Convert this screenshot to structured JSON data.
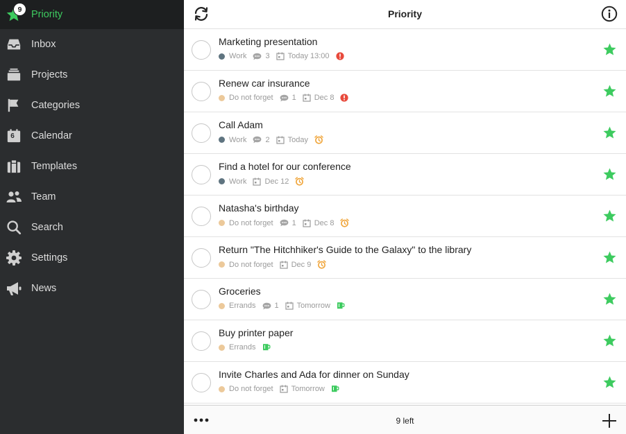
{
  "colors": {
    "accent": "#3dcb5f",
    "sidebar_bg": "#2b2d2f",
    "work_dot": "#5f7480",
    "soft_dot": "#ecc99a",
    "urgent": "#e84a3c",
    "reminder": "#f0a53a",
    "coffee": "#3dcb5f"
  },
  "sidebar": {
    "items": [
      {
        "label": "Priority",
        "icon": "star-icon",
        "badge": "9",
        "active": true
      },
      {
        "label": "Inbox",
        "icon": "inbox-icon"
      },
      {
        "label": "Projects",
        "icon": "projects-icon"
      },
      {
        "label": "Categories",
        "icon": "flag-icon"
      },
      {
        "label": "Calendar",
        "icon": "calendar-icon",
        "day": "6"
      },
      {
        "label": "Templates",
        "icon": "clipboard-icon"
      },
      {
        "label": "Team",
        "icon": "team-icon"
      },
      {
        "label": "Search",
        "icon": "search-icon"
      },
      {
        "label": "Settings",
        "icon": "gear-icon"
      },
      {
        "label": "News",
        "icon": "megaphone-icon"
      }
    ]
  },
  "header": {
    "title": "Priority"
  },
  "tasks": [
    {
      "title": "Marketing presentation",
      "category": "Work",
      "dot": "#5f7480",
      "comments": "3",
      "date": "Today 13:00",
      "status": "urgent"
    },
    {
      "title": "Renew car insurance",
      "category": "Do not forget",
      "dot": "#ecc99a",
      "comments": "1",
      "date": "Dec 8",
      "status": "urgent"
    },
    {
      "title": "Call Adam",
      "category": "Work",
      "dot": "#5f7480",
      "comments": "2",
      "date": "Today",
      "status": "reminder"
    },
    {
      "title": "Find a hotel for our conference",
      "category": "Work",
      "dot": "#5f7480",
      "date": "Dec 12",
      "status": "reminder"
    },
    {
      "title": "Natasha's birthday",
      "category": "Do not forget",
      "dot": "#ecc99a",
      "comments": "1",
      "date": "Dec 8",
      "status": "reminder"
    },
    {
      "title": "Return \"The Hitchhiker's Guide to the Galaxy\" to the library",
      "category": "Do not forget",
      "dot": "#ecc99a",
      "date": "Dec 9",
      "status": "reminder"
    },
    {
      "title": "Groceries",
      "category": "Errands",
      "dot": "#ecc99a",
      "comments": "1",
      "date": "Tomorrow",
      "status": "coffee"
    },
    {
      "title": "Buy printer paper",
      "category": "Errands",
      "dot": "#ecc99a",
      "status": "coffee"
    },
    {
      "title": "Invite Charles and Ada for dinner on Sunday",
      "category": "Do not forget",
      "dot": "#ecc99a",
      "date": "Tomorrow",
      "status": "coffee"
    }
  ],
  "footer": {
    "count": "9 left"
  }
}
